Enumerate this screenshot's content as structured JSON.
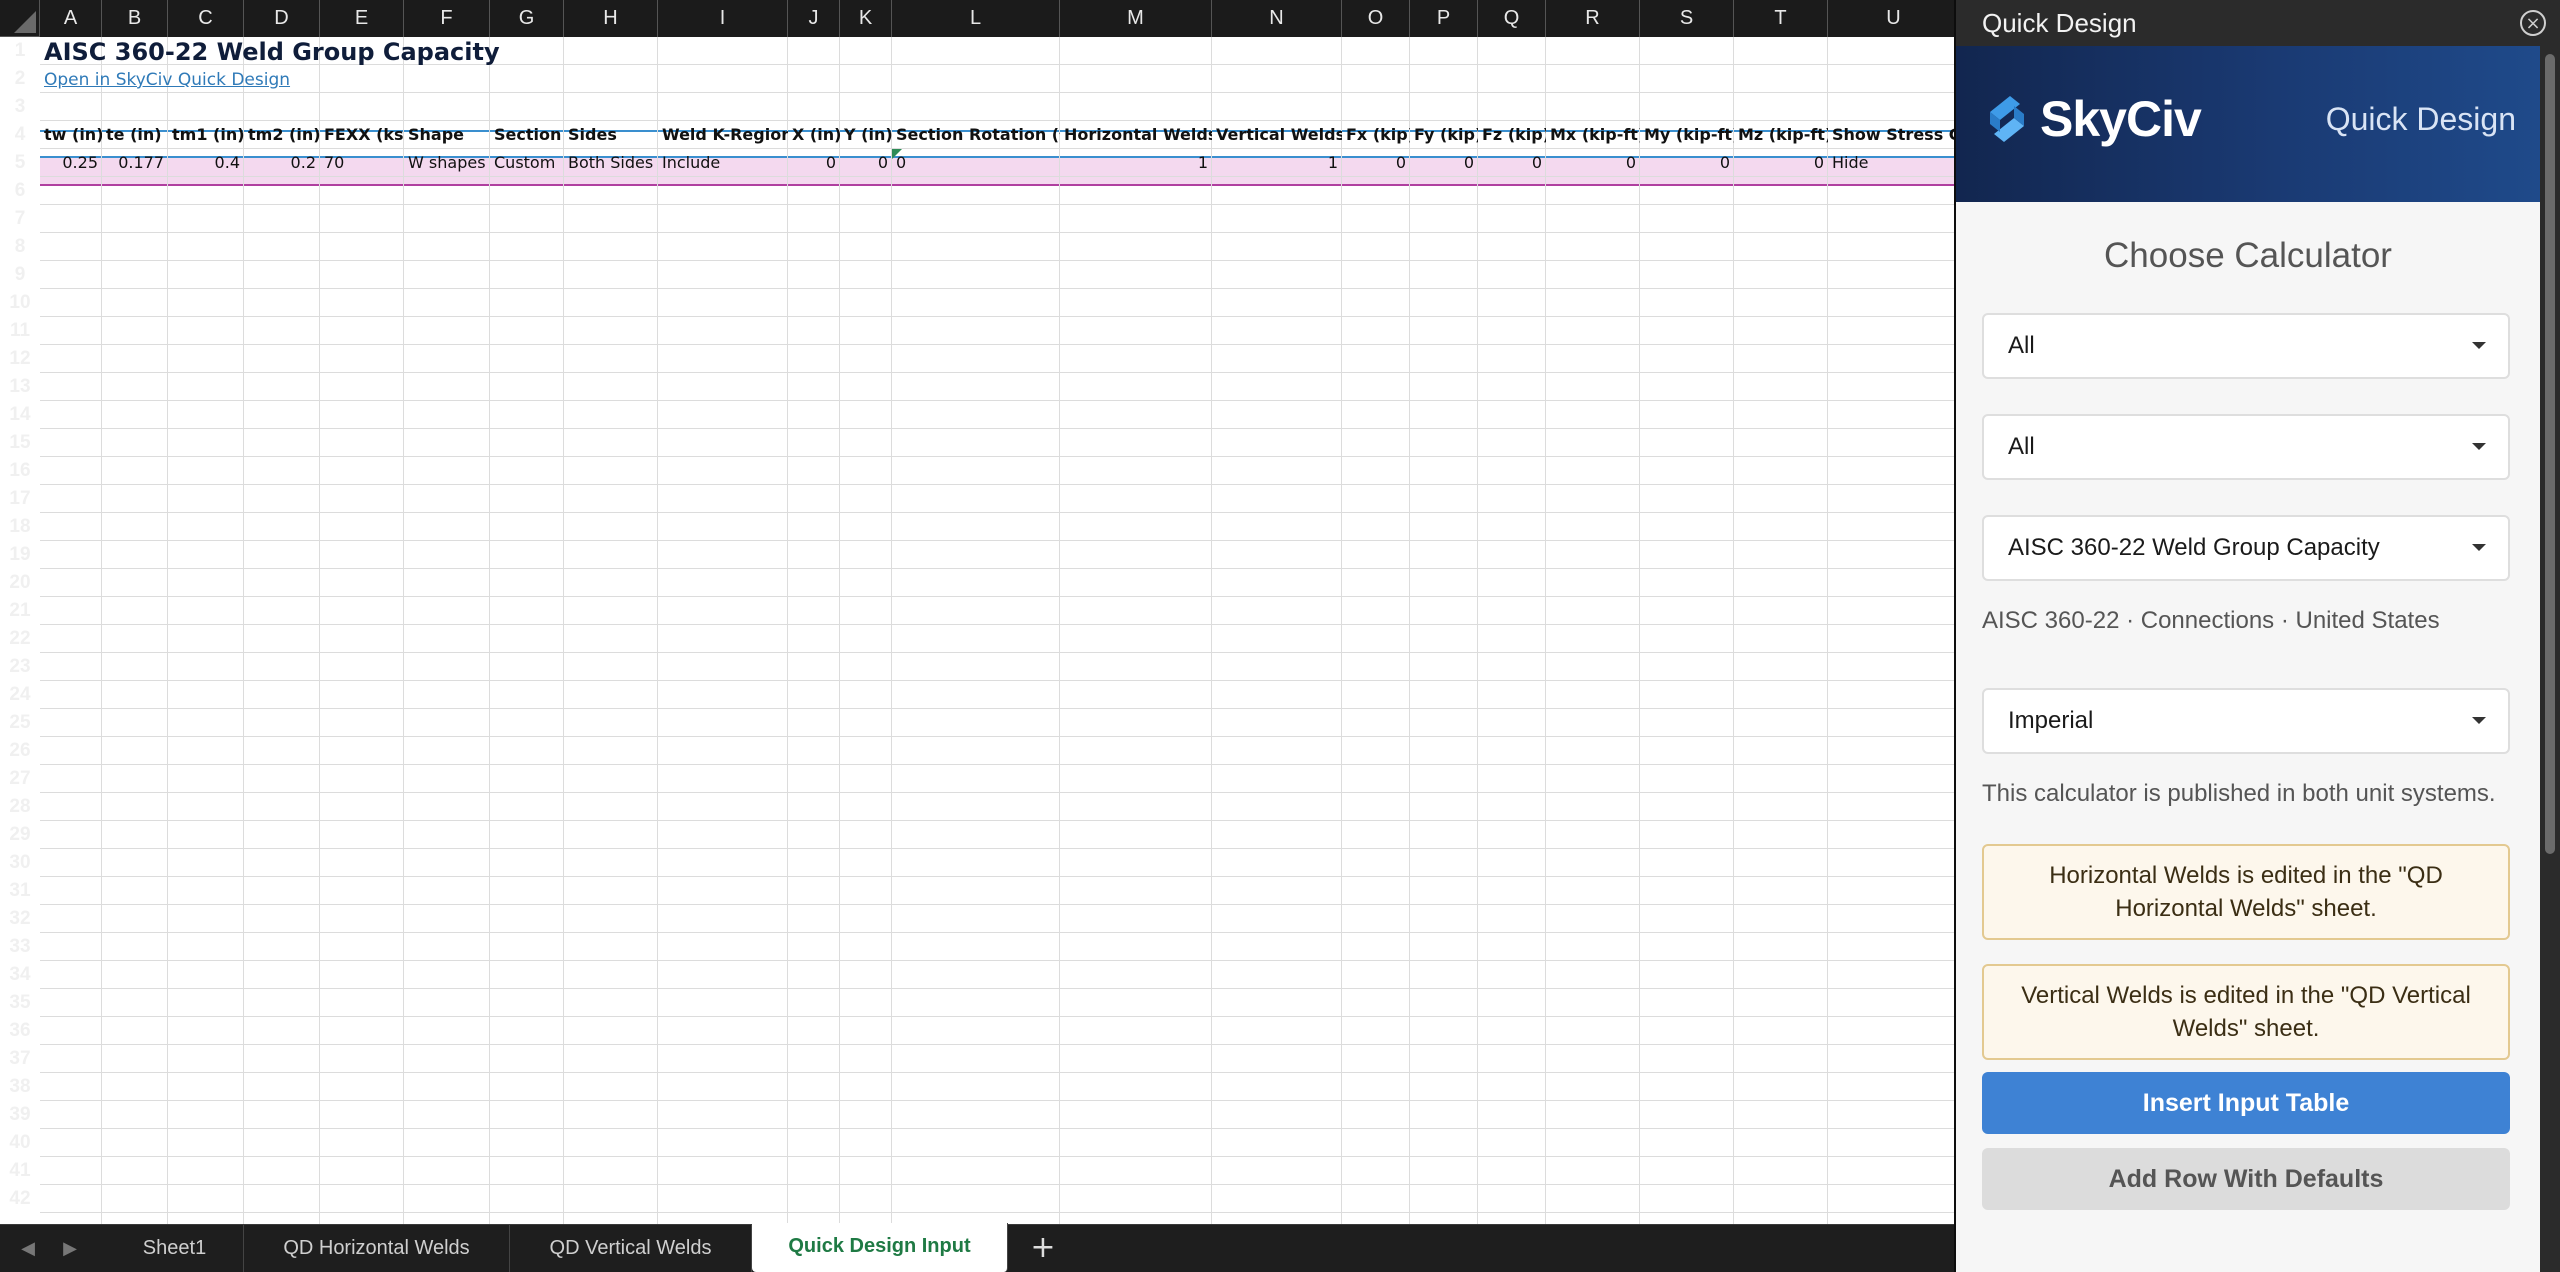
{
  "sheet": {
    "columns": [
      "A",
      "B",
      "C",
      "D",
      "E",
      "F",
      "G",
      "H",
      "I",
      "J",
      "K",
      "L",
      "M",
      "N",
      "O",
      "P",
      "Q",
      "R",
      "S",
      "T",
      "U"
    ],
    "rows": [
      "1",
      "2",
      "3",
      "4",
      "5",
      "6",
      "7",
      "8",
      "9",
      "10",
      "11",
      "12",
      "13",
      "14",
      "15",
      "16",
      "17",
      "18",
      "19",
      "20",
      "21",
      "22",
      "23",
      "24",
      "25",
      "26",
      "27",
      "28",
      "29",
      "30",
      "31",
      "32",
      "33",
      "34",
      "35",
      "36",
      "37",
      "38",
      "39",
      "40",
      "41",
      "42"
    ],
    "title": "AISC 360-22 Weld Group Capacity",
    "link_text": "Open in SkyCiv Quick Design",
    "headers": [
      "tw (in)",
      "te (in)",
      "tm1 (in)",
      "tm2 (in)",
      "FEXX (ksi)",
      "Shape",
      "Section",
      "Sides",
      "Weld K-Region",
      "X (in)",
      "Y (in)",
      "Section Rotation (↷",
      "Horizontal Welds",
      "Vertical Welds",
      "Fx (kip)",
      "Fy (kip)",
      "Fz (kip)",
      "Mx (kip-ft)",
      "My (kip-ft)",
      "Mz (kip-ft)",
      "Show Stress Gra"
    ],
    "row5": [
      "0.25",
      "0.177",
      "0.4",
      "0.2",
      "70",
      "W shapes",
      "Custom",
      "Both Sides",
      "Include",
      "0",
      "0",
      "0",
      "1",
      "1",
      "0",
      "0",
      "0",
      "0",
      "0",
      "0",
      "Hide"
    ]
  },
  "tabs": {
    "items": [
      "Sheet1",
      "QD Horizontal Welds",
      "QD Vertical Welds",
      "Quick Design Input"
    ],
    "active": "Quick Design Input",
    "add": "+"
  },
  "pane": {
    "title": "Quick Design",
    "close_icon": "×",
    "brand": "SkyCiv",
    "product": "Quick Design",
    "heading": "Choose Calculator",
    "select1": "All",
    "select2": "All",
    "select3": "AISC 360-22 Weld Group Capacity",
    "meta": "AISC 360-22 · Connections · United States",
    "units_select": "Imperial",
    "units_note": "This calculator is published in both unit systems.",
    "info_horizontal": "Horizontal Welds is edited in the \"QD Horizontal Welds\" sheet.",
    "info_vertical": "Vertical Welds is edited in the \"QD Vertical Welds\" sheet.",
    "insert_button": "Insert Input Table",
    "add_row_button": "Add Row With Defaults"
  },
  "colors": {
    "accent_blue": "#3e82d4",
    "header_band": "#3a8fcf",
    "data_band": "#f4d9ef",
    "active_tab_text": "#1f7a44"
  }
}
